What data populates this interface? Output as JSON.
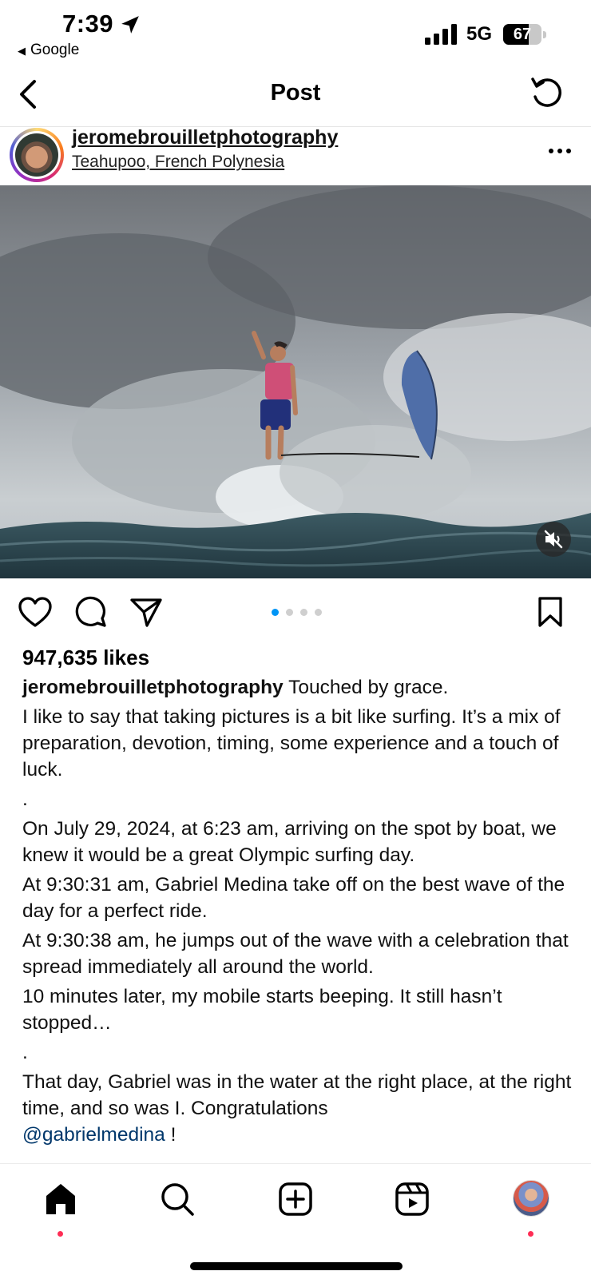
{
  "status_bar": {
    "time": "7:39",
    "back_app": "Google",
    "network": "5G",
    "battery_level": "67",
    "battery_fraction": 0.67
  },
  "header": {
    "title": "Post"
  },
  "post": {
    "username": "jeromebrouilletphotography",
    "location": "Teahupoo, French Polynesia",
    "carousel": {
      "count": 4,
      "active_index": 0,
      "active_color": "#0095f6"
    },
    "likes": "947,635 likes",
    "caption": {
      "author": "jeromebrouilletphotography",
      "title": "Touched by grace.",
      "paragraphs": [
        "I like to say that taking pictures is a bit like surfing. It’s a mix of preparation, devotion, timing, some experience and a touch of luck.",
        ".",
        "On July 29, 2024, at 6:23 am, arriving on the spot by boat, we knew it would be a great Olympic surfing day.",
        "At 9:30:31 am, Gabriel Medina take off on the best wave of the day for a perfect ride.",
        "At 9:30:38 am, he jumps out of the wave with a celebration that spread immediately all around the world.",
        "10 minutes later, my mobile starts beeping. It still hasn’t stopped…",
        ".",
        "That day, Gabriel was in the water at the right place, at the right time, and so was I.  Congratulations"
      ],
      "mention": "@gabrielmedina",
      "ending": " !"
    }
  },
  "icons": {
    "back": "chevron-left-icon",
    "refresh": "refresh-icon",
    "more": "more-horizontal-icon",
    "mute": "speaker-muted-icon",
    "like": "heart-icon",
    "comment": "comment-bubble-icon",
    "share": "paper-plane-icon",
    "save": "bookmark-icon",
    "tabs": [
      "home-icon",
      "search-icon",
      "create-post-icon",
      "reels-icon",
      "profile-avatar"
    ]
  },
  "colors": {
    "notification_dot": "#ff2d55",
    "mention": "#00376b"
  }
}
